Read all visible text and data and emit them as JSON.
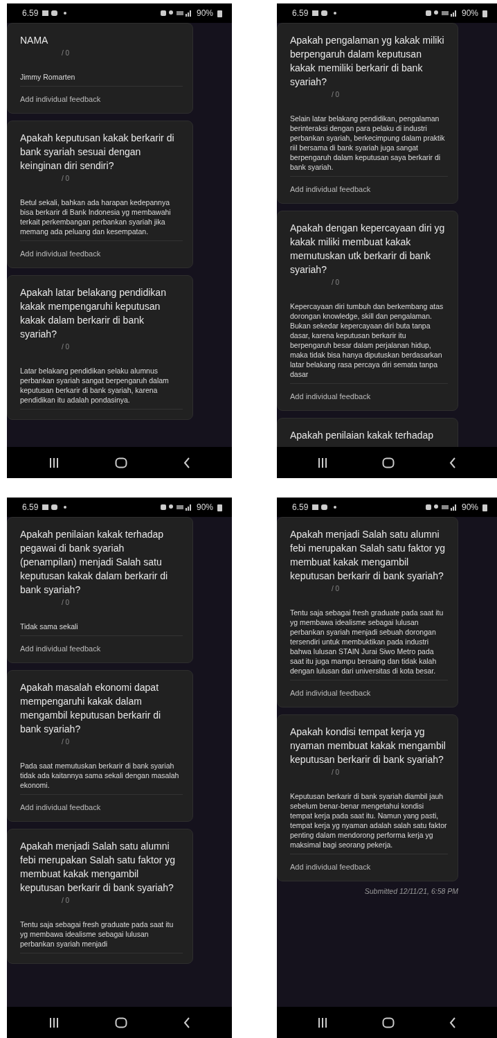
{
  "screens": [
    {
      "status_bar": {
        "time": "6.59",
        "battery": "90%"
      },
      "cards": [
        {
          "question": "NAMA",
          "score": "/ 0",
          "answer": "Jimmy Romarten",
          "feedback_link": "Add individual feedback"
        },
        {
          "question": "Apakah keputusan kakak berkarir di bank syariah sesuai dengan keinginan diri sendiri?",
          "score": "/ 0",
          "answer": "Betul sekali, bahkan ada harapan kedepannya bisa berkarir di Bank Indonesia yg membawahi terkait perkembangan perbankan syariah jika memang ada peluang dan kesempatan.",
          "feedback_link": "Add individual feedback"
        },
        {
          "question": "Apakah latar belakang pendidikan kakak mempengaruhi keputusan kakak dalam berkarir di bank syariah?",
          "score": "/ 0",
          "answer": "Latar belakang pendidikan selaku alumnus perbankan syariah sangat berpengaruh dalam keputusan berkarir di bank syariah, karena pendidikan itu adalah pondasinya."
        }
      ]
    },
    {
      "status_bar": {
        "time": "6.59",
        "battery": "90%"
      },
      "cards": [
        {
          "question": "Apakah pengalaman yg kakak miliki berpengaruh dalam keputusan kakak memiliki berkarir di bank syariah?",
          "score": "/ 0",
          "answer": "Selain latar belakang pendidikan, pengalaman berinteraksi dengan para pelaku di industri perbankan syariah, berkecimpung dalam praktik riil bersama di bank syariah juga sangat berpengaruh dalam keputusan saya berkarir di bank syariah.",
          "feedback_link": "Add individual feedback"
        },
        {
          "question": "Apakah dengan kepercayaan diri yg kakak miliki membuat kakak memutuskan utk berkarir di bank syariah?",
          "score": "/ 0",
          "answer": "Kepercayaan diri tumbuh dan berkembang atas dorongan knowledge, skill dan pengalaman. Bukan sekedar kepercayaan diri buta tanpa dasar, karena keputusan berkarir itu berpengaruh besar dalam perjalanan hidup, maka tidak bisa hanya diputuskan berdasarkan latar belakang rasa percaya diri semata tanpa dasar",
          "feedback_link": "Add individual feedback"
        },
        {
          "question": "Apakah penilaian kakak terhadap"
        }
      ]
    },
    {
      "status_bar": {
        "time": "6.59",
        "battery": "90%"
      },
      "cards": [
        {
          "question": "Apakah penilaian kakak terhadap pegawai di bank syariah (penampilan) menjadi Salah satu keputusan kakak dalam berkarir di bank syariah?",
          "score": "/ 0",
          "answer": "Tidak sama sekali",
          "feedback_link": "Add individual feedback"
        },
        {
          "question": "Apakah masalah ekonomi dapat mempengaruhi kakak dalam mengambil keputusan berkarir di bank syariah?",
          "score": "/ 0",
          "answer": "Pada saat memutuskan berkarir di bank syariah tidak ada kaitannya sama sekali dengan masalah ekonomi.",
          "feedback_link": "Add individual feedback"
        },
        {
          "question": "Apakah menjadi Salah satu alumni febi merupakan Salah satu faktor yg membuat kakak mengambil keputusan berkarir di bank syariah?",
          "score": "/ 0",
          "answer": "Tentu saja sebagai fresh graduate pada saat itu yg membawa idealisme sebagai lulusan perbankan syariah menjadi"
        }
      ]
    },
    {
      "status_bar": {
        "time": "6.59",
        "battery": "90%"
      },
      "cards": [
        {
          "question": "Apakah menjadi Salah satu alumni febi merupakan Salah satu faktor yg membuat kakak mengambil keputusan berkarir di bank syariah?",
          "score": "/ 0",
          "answer": "Tentu saja sebagai fresh graduate pada saat itu yg membawa idealisme sebagai lulusan perbankan syariah menjadi sebuah dorongan tersendiri untuk membuktikan pada industri bahwa lulusan STAIN Jurai Siwo Metro pada saat itu juga mampu bersaing dan tidak kalah dengan lulusan dari universitas di kota besar.",
          "feedback_link": "Add individual feedback"
        },
        {
          "question": "Apakah kondisi tempat kerja yg nyaman membuat kakak mengambil keputusan berkarir di bank syariah?",
          "score": "/ 0",
          "answer": "Keputusan berkarir di bank syariah diambil jauh sebelum benar-benar mengetahui kondisi tempat kerja pada saat itu. Namun yang pasti, tempat kerja yg nyaman adalah salah satu faktor penting dalam mendorong performa kerja yg maksimal bagi seorang pekerja.",
          "feedback_link": "Add individual feedback"
        }
      ],
      "footer": "Submitted 12/11/21, 6:58 PM"
    }
  ]
}
